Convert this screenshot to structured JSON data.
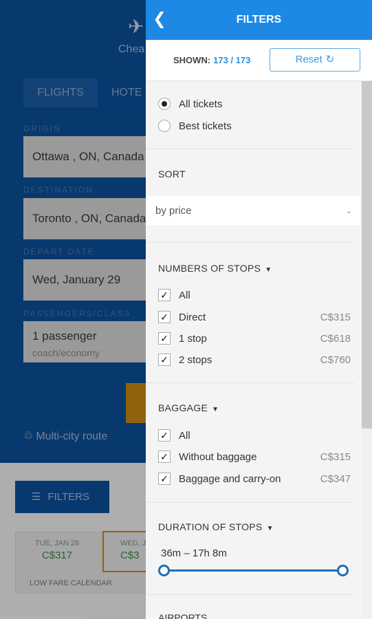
{
  "background": {
    "logo_text": "Chea",
    "tabs": [
      "FLIGHTS",
      "HOTE"
    ],
    "origin_label": "ORIGIN",
    "origin_value": "Ottawa , ON, Canada",
    "destination_label": "DESTINATION",
    "destination_value": "Toronto , ON, Canada",
    "depart_label": "DEPART DATE",
    "depart_value": "Wed, January 29",
    "passengers_label": "PASSENGERS/CLASS",
    "passengers_value": "1 passenger",
    "class_value": "coach/economy",
    "multi_city": "Multi-city route",
    "filters_button": "FILTERS",
    "calendar": [
      {
        "date": "TUE, JAN 28",
        "price": "C$317"
      },
      {
        "date": "WED, J",
        "price": "C$3"
      }
    ],
    "calendar_link": "LOW FARE CALENDAR"
  },
  "panel": {
    "title": "FILTERS",
    "shown_label": "SHOWN:",
    "shown_count": "173 / 173",
    "reset_label": "Reset",
    "ticket_options": [
      {
        "label": "All tickets",
        "selected": true
      },
      {
        "label": "Best tickets",
        "selected": false
      }
    ],
    "sort_title": "SORT",
    "sort_value": "by price",
    "stops_title": "NUMBERS OF STOPS",
    "stops": [
      {
        "label": "All",
        "price": "",
        "checked": true
      },
      {
        "label": "Direct",
        "price": "C$315",
        "checked": true
      },
      {
        "label": "1 stop",
        "price": "C$618",
        "checked": true
      },
      {
        "label": "2 stops",
        "price": "C$760",
        "checked": true
      }
    ],
    "baggage_title": "BAGGAGE",
    "baggage": [
      {
        "label": "All",
        "price": "",
        "checked": true
      },
      {
        "label": "Without baggage",
        "price": "C$315",
        "checked": true
      },
      {
        "label": "Baggage and carry-on",
        "price": "C$347",
        "checked": true
      }
    ],
    "duration_title": "DURATION OF STOPS",
    "duration_range": "36m – 17h 8m",
    "airports_title": "AIRPORTS"
  },
  "colors": {
    "header": "#1e88e5",
    "accent": "#0b4f9a",
    "price_green": "#3f8b3f"
  }
}
